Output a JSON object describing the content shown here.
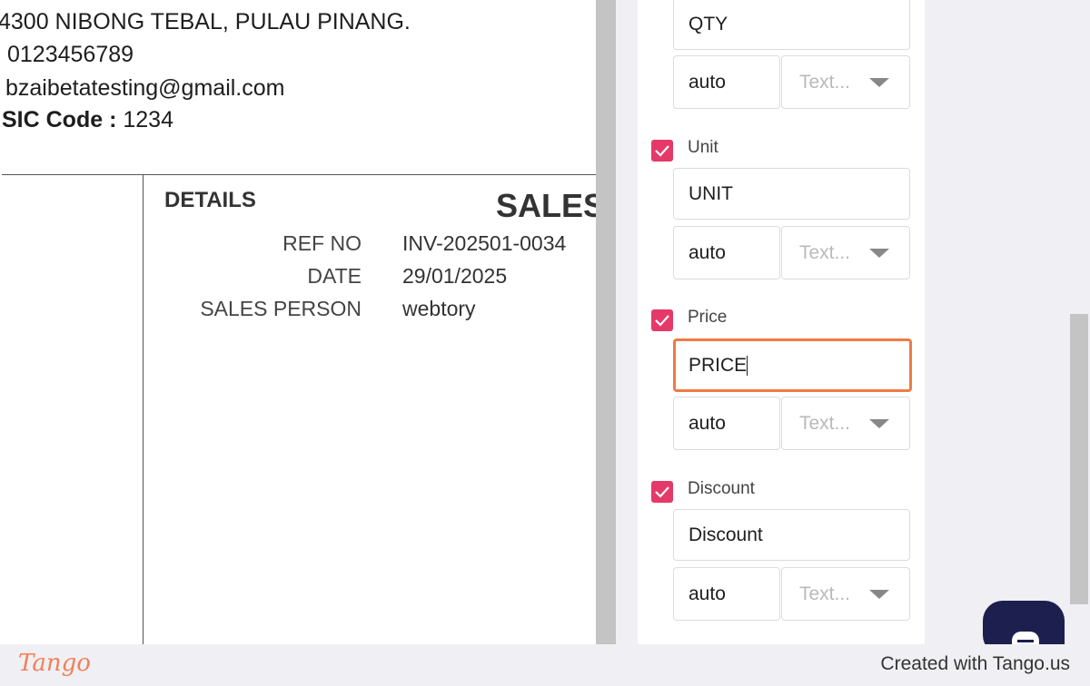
{
  "preview": {
    "address_line": "4300 NIBONG TEBAL, PULAU PINANG.",
    "phone": "0123456789",
    "email": "bzaibetatesting@gmail.com",
    "sic_label": "SIC Code :",
    "sic_value": "1234",
    "details_heading": "DETAILS",
    "doc_title": "SALES",
    "details": [
      {
        "label": "REF NO",
        "value": "INV-202501-0034"
      },
      {
        "label": "DATE",
        "value": "29/01/2025"
      },
      {
        "label": "SALES PERSON",
        "value": "webtory"
      }
    ]
  },
  "settings": {
    "qty_field_value": "QTY",
    "qty_width": "auto",
    "qty_format_placeholder": "Text...",
    "columns": [
      {
        "checked": true,
        "label": "Unit",
        "value": "UNIT",
        "width": "auto",
        "format": "Text..."
      },
      {
        "checked": true,
        "label": "Price",
        "value": "PRICE",
        "width": "auto",
        "format": "Text..."
      },
      {
        "checked": true,
        "label": "Discount",
        "value": "Discount",
        "width": "auto",
        "format": "Text..."
      }
    ]
  },
  "colors": {
    "checkbox": "#e5396a",
    "active_border": "#f07a45",
    "chat_button": "#1d1f4f"
  },
  "footer": {
    "logo": "Tango",
    "credit": "Created with Tango.us"
  }
}
